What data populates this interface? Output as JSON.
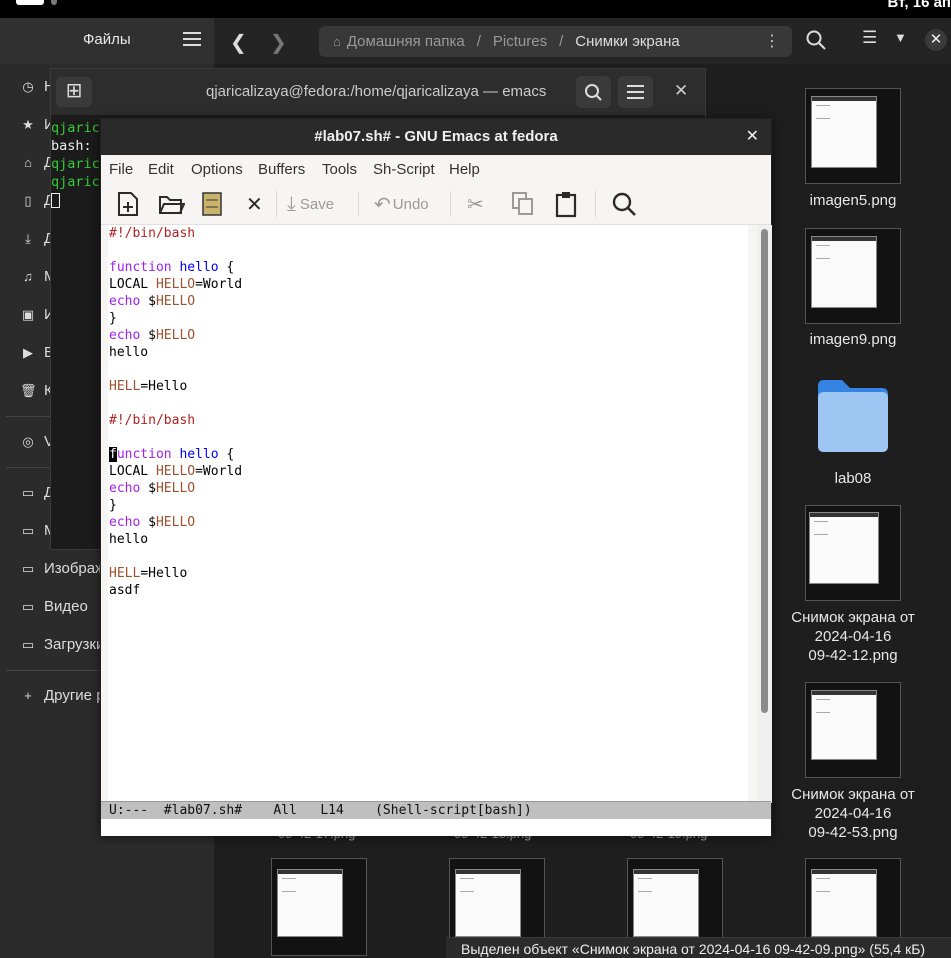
{
  "topbar": {
    "clock": "Вт, 16 ап"
  },
  "nautilus": {
    "sidebar_title": "Файлы",
    "path": [
      "Домашняя папка",
      "Pictures",
      "Снимки экрана"
    ],
    "sidebar_items": [
      {
        "icon": "◷",
        "label": "Н"
      },
      {
        "icon": "★",
        "label": "И"
      },
      {
        "icon": "⌂",
        "label": "Д"
      },
      {
        "icon": "▯",
        "label": "Д"
      },
      {
        "icon": "⤓",
        "label": "Д"
      },
      {
        "icon": "♫",
        "label": "М"
      },
      {
        "icon": "▣",
        "label": "И"
      },
      {
        "icon": "▶",
        "label": "В"
      },
      {
        "icon": "🗑",
        "label": "К"
      },
      {
        "icon": "◎",
        "label": "V"
      },
      {
        "icon": "▭",
        "label": "Д"
      },
      {
        "icon": "▭",
        "label": "М"
      },
      {
        "icon": "▭",
        "label": "Изображ"
      },
      {
        "icon": "▭",
        "label": "Видео"
      },
      {
        "icon": "▭",
        "label": "Загрузки"
      },
      {
        "icon": "+",
        "label": "Другие р"
      }
    ],
    "files": [
      {
        "name": "imagen5.png"
      },
      {
        "name": "imagen9.png"
      },
      {
        "name": "lab08"
      },
      {
        "name_l1": "Снимок экрана от",
        "name_l2": "2024-04-16",
        "name_l3": "09-42-12.png"
      },
      {
        "name_l1": "Снимок экрана от",
        "name_l2": "2024-04-16",
        "name_l3": "09-42-53.png"
      }
    ],
    "partial_labels": [
      "09-42-17.png",
      "09-42-18.png",
      "09-42-19.png"
    ],
    "status": "Выделен объект «Снимок экрана от 2024-04-16 09-42-09.png» (55,4 кБ)"
  },
  "terminal": {
    "title": "qjaricalizaya@fedora:/home/qjaricalizaya — emacs",
    "lines": [
      {
        "text": "qjaric",
        "color": "g"
      },
      {
        "text": "bash:",
        "color": "w"
      },
      {
        "text": "qjaric",
        "color": "g"
      },
      {
        "text": "qjaric",
        "color": "g"
      }
    ]
  },
  "emacs": {
    "title": "#lab07.sh# - GNU Emacs at fedora",
    "menu": [
      "File",
      "Edit",
      "Options",
      "Buffers",
      "Tools",
      "Sh-Script",
      "Help"
    ],
    "toolbar": {
      "save": "Save",
      "undo": "Undo"
    },
    "modeline": "U:---  #lab07.sh#    All   L14    (Shell-script[bash])",
    "code": {
      "shebang_a": "#!/bin/bash",
      "function_kw": "function",
      "fn_name": "hello",
      "brace_open": " {",
      "local_kw": "LOCAL ",
      "var": "HELLO",
      "assign_world": "=World",
      "echo": "echo",
      "dollar": " $",
      "brace_close": "}",
      "hello": "hello",
      "hell_var": "HELL",
      "assign_hello": "=Hello",
      "cursor_char": "f",
      "function_rest": "unction",
      "last_line": "asdf"
    }
  }
}
